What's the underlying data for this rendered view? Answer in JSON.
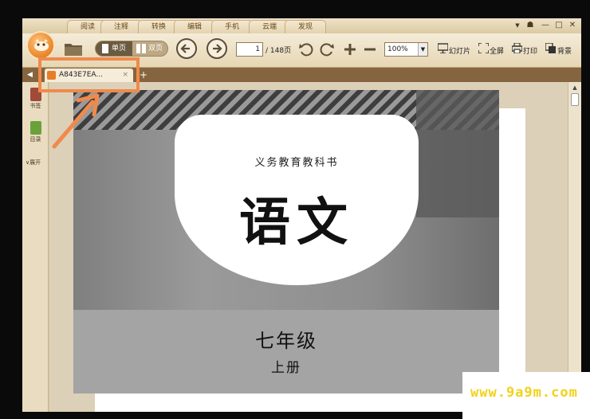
{
  "menu": {
    "tabs": [
      "阅读",
      "注释",
      "转换",
      "编辑",
      "手机",
      "云端",
      "发现"
    ]
  },
  "window_controls": {
    "menu": "▼",
    "skin": "☗",
    "minimize": "—",
    "maximize": "□",
    "close": "✕"
  },
  "toolbar": {
    "single_page": "单页",
    "double_page": "双页",
    "current_page": "1",
    "total_pages": "/ 148页",
    "zoom": "100%",
    "slideshow": "幻灯片",
    "fullscreen": "全屏",
    "print": "打印",
    "background": "背景"
  },
  "tabs": {
    "document_tab": "A843E7EA...",
    "close": "×",
    "add": "+"
  },
  "sidebar": {
    "bookmark": "书签",
    "contents": "目录",
    "expand": "展开"
  },
  "document": {
    "series": "义务教育教科书",
    "subject": "语文",
    "grade": "七年级",
    "volume": "上册"
  },
  "watermark": "www.9a9m.com",
  "colors": {
    "annotation": "#f08a4b",
    "accent": "#e87d28",
    "bookmark": "#a04a3a",
    "contents": "#6aa23a"
  }
}
